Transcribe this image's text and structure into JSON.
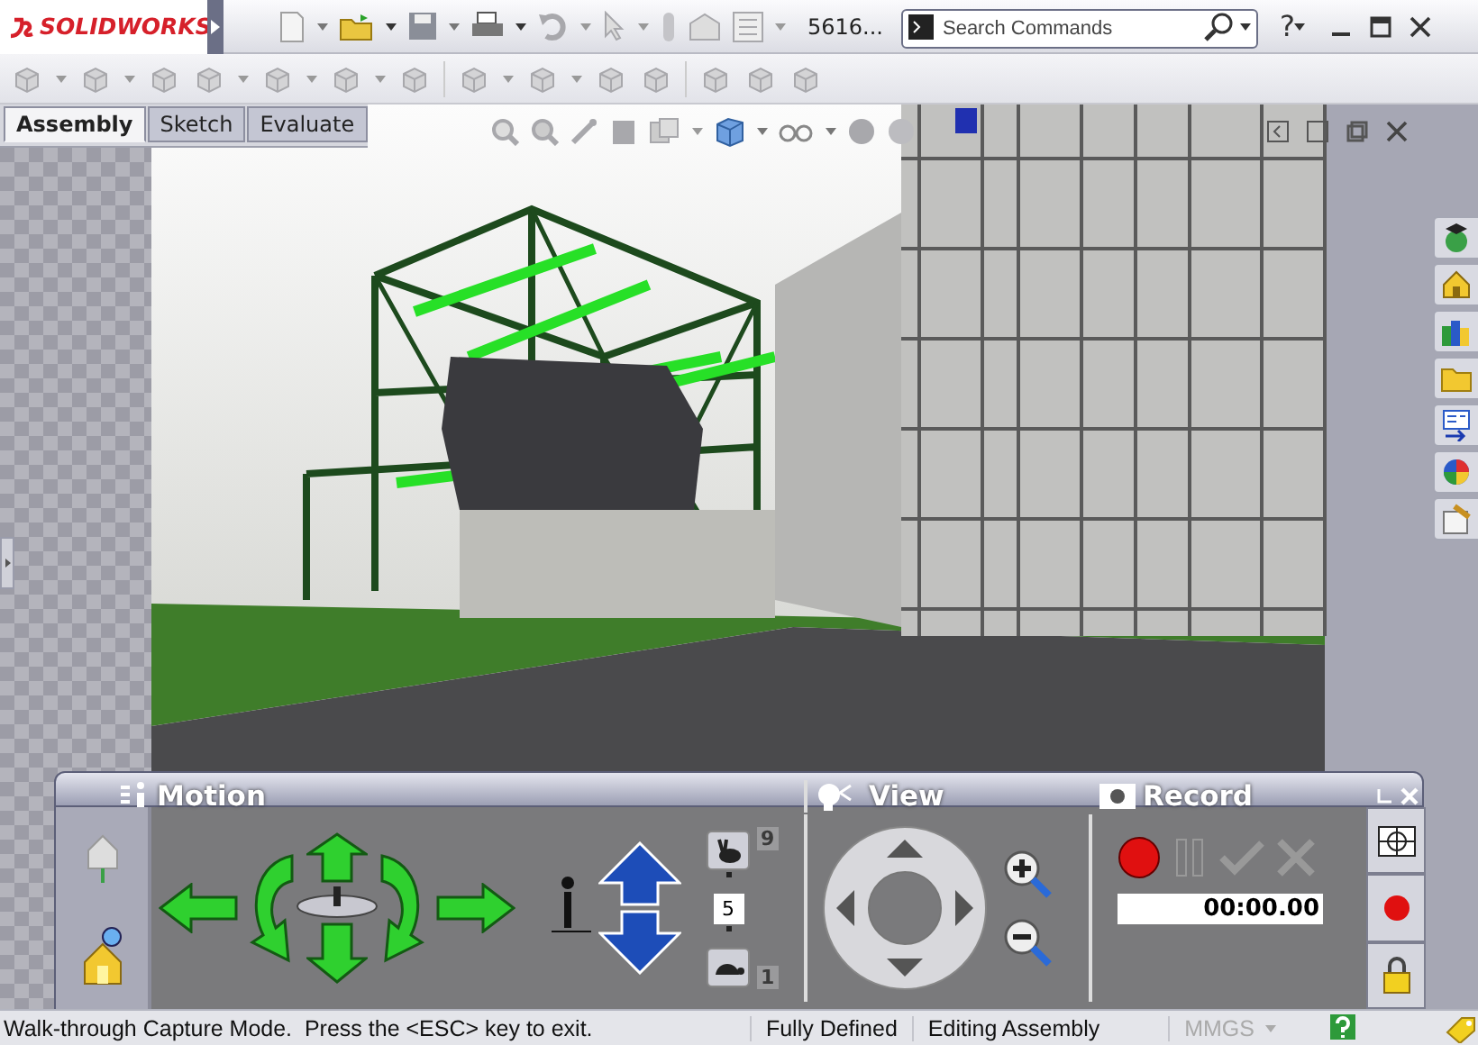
{
  "app": {
    "logo_text": "SOLIDWORKS",
    "document_title": "5616...",
    "search": {
      "placeholder": "Search Commands"
    },
    "help": "?"
  },
  "command_tabs": [
    {
      "label": "Assembly",
      "selected": true
    },
    {
      "label": "Sketch",
      "selected": false
    },
    {
      "label": "Evaluate",
      "selected": false
    }
  ],
  "walkthrough_panel": {
    "sections": [
      {
        "kind": "motion",
        "title": "Motion"
      },
      {
        "kind": "view",
        "title": "View"
      },
      {
        "kind": "record",
        "title": "Record"
      }
    ],
    "speed": {
      "max": "9",
      "value": "5",
      "min": "1"
    },
    "timer": "00:00.00"
  },
  "status_bar": {
    "message": "Walk-through Capture Mode.  Press the <ESC> key to exit.",
    "items": [
      {
        "text": "Fully Defined",
        "disabled": false
      },
      {
        "text": "Editing Assembly",
        "disabled": false
      },
      {
        "text": "MMGS",
        "disabled": true
      }
    ]
  }
}
